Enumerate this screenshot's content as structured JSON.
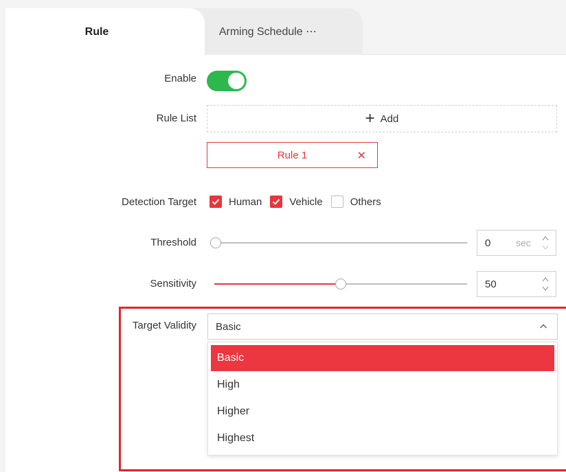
{
  "tabs": [
    {
      "label": "Rule",
      "active": true
    },
    {
      "label": "Arming Schedule ⋯",
      "active": false
    }
  ],
  "form": {
    "enable": {
      "label": "Enable",
      "value": true
    },
    "rule_list": {
      "label": "Rule List",
      "add_label": "Add",
      "rules": [
        {
          "label": "Rule 1",
          "selected": true
        }
      ]
    },
    "detection_target": {
      "label": "Detection Target",
      "options": [
        {
          "label": "Human",
          "checked": true
        },
        {
          "label": "Vehicle",
          "checked": true
        },
        {
          "label": "Others",
          "checked": false
        }
      ]
    },
    "threshold": {
      "label": "Threshold",
      "value": "0",
      "unit": "sec"
    },
    "sensitivity": {
      "label": "Sensitivity",
      "value": "50"
    },
    "target_validity": {
      "label": "Target Validity",
      "value": "Basic",
      "options": [
        "Basic",
        "High",
        "Higher",
        "Highest"
      ]
    }
  },
  "colors": {
    "accent": "#e8353e",
    "toggle_on": "#2db84d",
    "highlight": "#e0262e"
  },
  "icons": {
    "add": "plus-icon",
    "remove": "close-icon",
    "check": "check-icon",
    "spin": "spinner-arrows-icon",
    "dropdown": "chevron-up-icon"
  }
}
